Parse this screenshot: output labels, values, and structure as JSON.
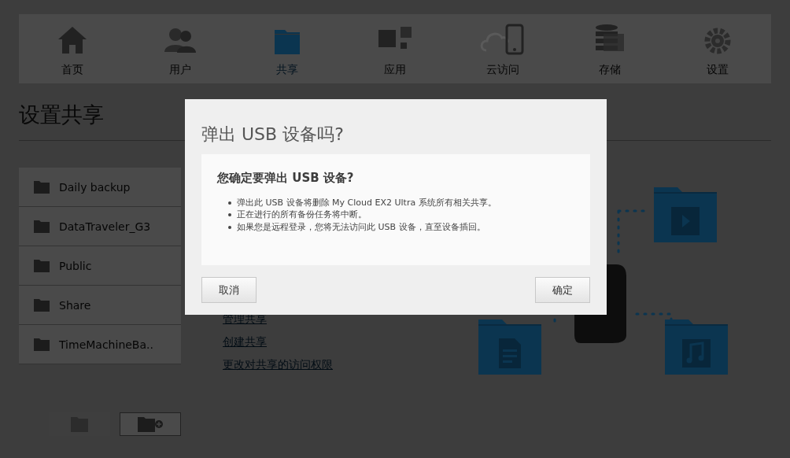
{
  "nav": {
    "items": [
      {
        "label": "首页",
        "selected": false
      },
      {
        "label": "用户",
        "selected": false
      },
      {
        "label": "共享",
        "selected": true
      },
      {
        "label": "应用",
        "selected": false
      },
      {
        "label": "云访问",
        "selected": false
      },
      {
        "label": "存储",
        "selected": false
      },
      {
        "label": "设置",
        "selected": false
      }
    ]
  },
  "page_title": "设置共享",
  "shares": [
    {
      "name": "Daily backup"
    },
    {
      "name": "DataTraveler_G3"
    },
    {
      "name": "Public"
    },
    {
      "name": "Share"
    },
    {
      "name": "TimeMachineBa.."
    }
  ],
  "share_toolbar": [
    {
      "kind": "details",
      "disabled": true
    },
    {
      "kind": "add",
      "disabled": false
    }
  ],
  "links": [
    "管理共享",
    "创建共享",
    "更改对共享的访问权限"
  ],
  "dialog": {
    "title": "弹出 USB 设备吗?",
    "heading": "您确定要弹出 USB 设备?",
    "bullets": [
      "弹出此 USB 设备将删除 My Cloud EX2 Ultra 系统所有相关共享。",
      "正在进行的所有备份任务将中断。",
      "如果您是远程登录，您将无法访问此 USB 设备，直至设备插回。"
    ],
    "cancel": "取消",
    "ok": "确定"
  }
}
